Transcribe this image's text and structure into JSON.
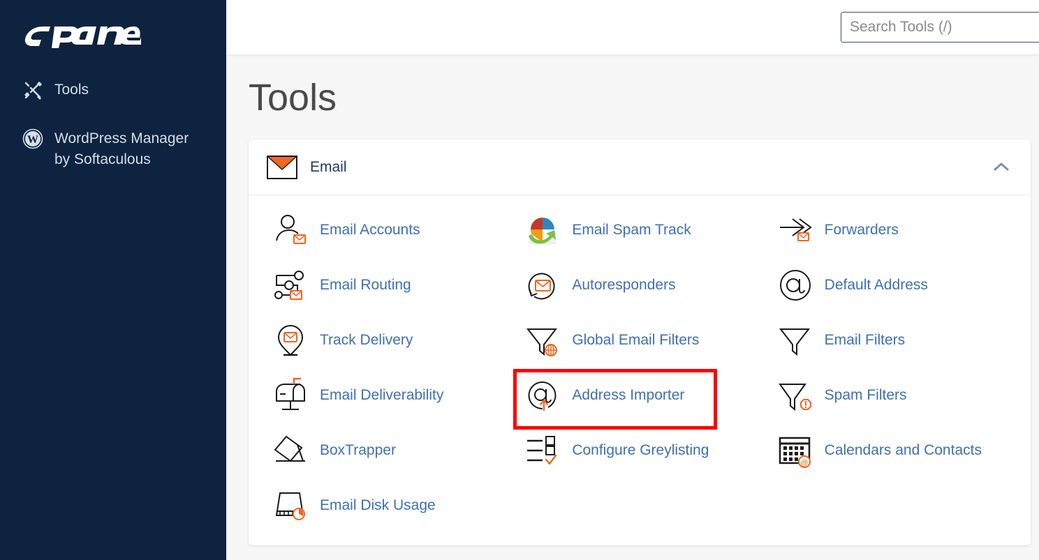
{
  "sidebar": {
    "logo_text": "cPanel",
    "items": [
      {
        "label": "Tools",
        "sub": "",
        "icon": "tools-icon"
      },
      {
        "label": "WordPress Manager",
        "sub": "by Softaculous",
        "icon": "wordpress-icon"
      }
    ]
  },
  "header": {
    "search_placeholder": "Search Tools (/)",
    "search_value": ""
  },
  "main": {
    "title": "Tools"
  },
  "section": {
    "title": "Email",
    "icon": "envelope-icon",
    "collapse_icon": "chevron-up-icon",
    "expanded": true
  },
  "tools": [
    {
      "label": "Email Accounts",
      "icon": "user-envelope-icon",
      "highlighted": false
    },
    {
      "label": "Email Spam Track",
      "icon": "spam-track-icon",
      "highlighted": false
    },
    {
      "label": "Forwarders",
      "icon": "forwarders-icon",
      "highlighted": false
    },
    {
      "label": "Email Routing",
      "icon": "routing-icon",
      "highlighted": false
    },
    {
      "label": "Autoresponders",
      "icon": "autoresponder-icon",
      "highlighted": false
    },
    {
      "label": "Default Address",
      "icon": "at-sign-icon",
      "highlighted": false
    },
    {
      "label": "Track Delivery",
      "icon": "map-pin-envelope-icon",
      "highlighted": false
    },
    {
      "label": "Global Email Filters",
      "icon": "funnel-globe-icon",
      "highlighted": false
    },
    {
      "label": "Email Filters",
      "icon": "funnel-icon",
      "highlighted": false
    },
    {
      "label": "Email Deliverability",
      "icon": "mailbox-icon",
      "highlighted": false
    },
    {
      "label": "Address Importer",
      "icon": "at-upload-icon",
      "highlighted": true
    },
    {
      "label": "Spam Filters",
      "icon": "funnel-alert-icon",
      "highlighted": false
    },
    {
      "label": "BoxTrapper",
      "icon": "box-trap-icon",
      "highlighted": false
    },
    {
      "label": "Configure Greylisting",
      "icon": "checklist-icon",
      "highlighted": false
    },
    {
      "label": "Calendars and Contacts",
      "icon": "calendar-at-icon",
      "highlighted": false
    },
    {
      "label": "Email Disk Usage",
      "icon": "disk-usage-icon",
      "highlighted": false
    }
  ],
  "colors": {
    "sidebar_bg": "#0e2340",
    "link_blue": "#3f6fb5",
    "accent_orange": "#f26522",
    "highlight_red": "#fe0000",
    "section_title": "#1f3864"
  }
}
